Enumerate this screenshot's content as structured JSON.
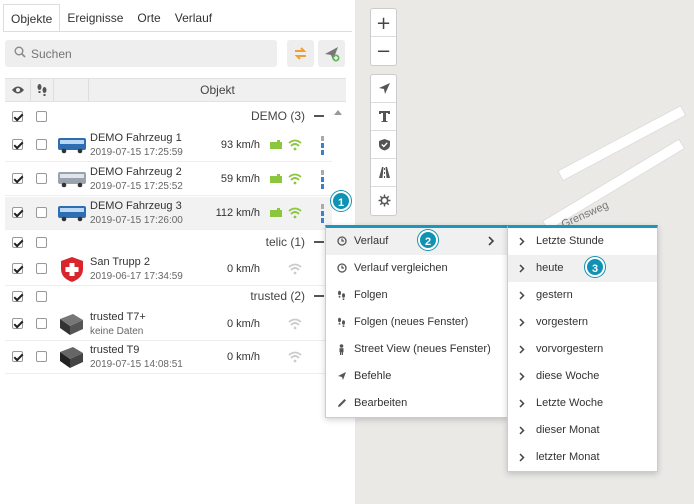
{
  "tabs": [
    "Objekte",
    "Ereignisse",
    "Orte",
    "Verlauf"
  ],
  "search": {
    "placeholder": "Suchen"
  },
  "table": {
    "header_object": "Objekt"
  },
  "groups": [
    {
      "label": "DEMO (3)"
    },
    {
      "label": "telic (1)"
    },
    {
      "label": "trusted (2)"
    }
  ],
  "vehicles": [
    {
      "name": "DEMO Fahrzeug 1",
      "date": "2019-07-15 17:25:59",
      "speed": "93 km/h"
    },
    {
      "name": "DEMO Fahrzeug 2",
      "date": "2019-07-15 17:25:52",
      "speed": "59 km/h"
    },
    {
      "name": "DEMO Fahrzeug 3",
      "date": "2019-07-15 17:26:00",
      "speed": "112 km/h"
    },
    {
      "name": "San Trupp 2",
      "date": "2019-06-17 17:34:59",
      "speed": "0 km/h"
    },
    {
      "name": "trusted T7+",
      "date": "keine Daten",
      "speed": "0 km/h"
    },
    {
      "name": "trusted T9",
      "date": "2019-07-15 14:08:51",
      "speed": "0 km/h"
    }
  ],
  "map": {
    "street": "Grensweg"
  },
  "badges": [
    "1",
    "2",
    "3"
  ],
  "context_menu": [
    {
      "label": "Verlauf",
      "icon": "clock-icon"
    },
    {
      "label": "Verlauf vergleichen",
      "icon": "clock-icon"
    },
    {
      "label": "Folgen",
      "icon": "footsteps-icon"
    },
    {
      "label": "Folgen (neues Fenster)",
      "icon": "footsteps-icon"
    },
    {
      "label": "Street View (neues Fenster)",
      "icon": "person-icon"
    },
    {
      "label": "Befehle",
      "icon": "send-icon"
    },
    {
      "label": "Bearbeiten",
      "icon": "pencil-icon"
    }
  ],
  "submenu": [
    {
      "label": "Letzte Stunde"
    },
    {
      "label": "heute"
    },
    {
      "label": "gestern"
    },
    {
      "label": "vorgestern"
    },
    {
      "label": "vorvorgestern"
    },
    {
      "label": "diese Woche"
    },
    {
      "label": "Letzte Woche"
    },
    {
      "label": "dieser Monat"
    },
    {
      "label": "letzter Monat"
    }
  ],
  "colors": {
    "accent": "#1a97bb",
    "badge": "#0f92b3",
    "engine": "#8cc63f",
    "bar_blue": "#3b7fd1"
  }
}
